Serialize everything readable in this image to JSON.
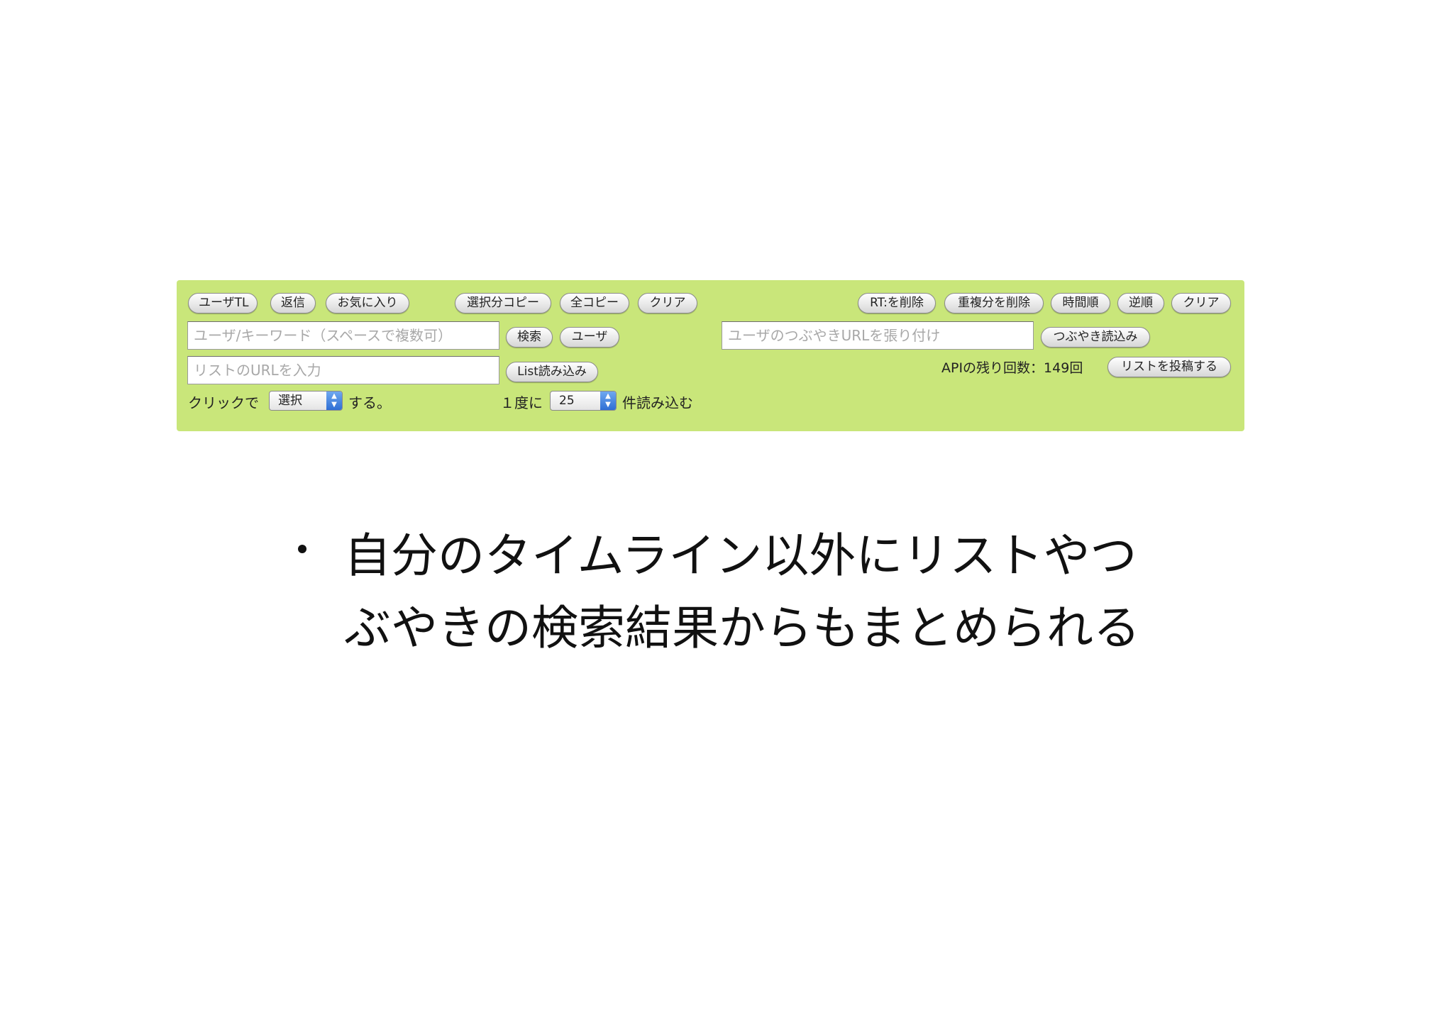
{
  "toolbar": {
    "row1_left": [
      "ユーザTL",
      "返信",
      "お気に入り"
    ],
    "row1_mid": [
      "選択分コピー",
      "全コピー",
      "クリア"
    ],
    "row1_right": [
      "RT:を削除",
      "重複分を削除",
      "時間順",
      "逆順",
      "クリア"
    ],
    "search": {
      "placeholder": "ユーザ/キーワード（スペースで複数可）",
      "search_button": "検索",
      "user_button": "ユーザ"
    },
    "tweet_url": {
      "placeholder": "ユーザのつぶやきURLを張り付け",
      "load_button": "つぶやき読込み"
    },
    "list": {
      "placeholder": "リストのURLを入力",
      "load_button": "List読み込み"
    },
    "api": {
      "remaining_label": "APIの残り回数：149回",
      "post_list_button": "リストを投稿する"
    },
    "click_action": {
      "prefix": "クリックで",
      "selected": "選択",
      "suffix": "する。"
    },
    "batch": {
      "prefix": "１度に",
      "selected": "25",
      "suffix": "件読み込む"
    }
  },
  "slide": {
    "bullet_line1": "自分のタイムライン以外にリストやつ",
    "bullet_line2": "ぶやきの検索結果からもまとめられる"
  },
  "colors": {
    "panel": "#c9e67a",
    "select_arrow": "#2f6fd4"
  }
}
